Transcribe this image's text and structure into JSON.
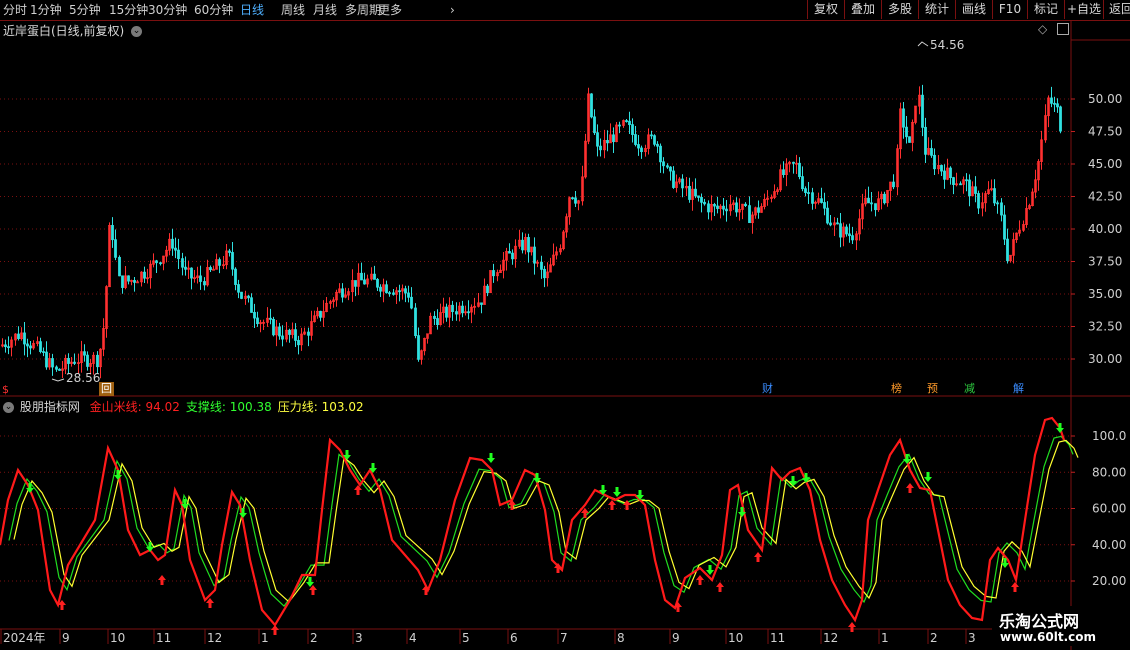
{
  "toolbar": {
    "periods": [
      "分时",
      "1分钟",
      "5分钟",
      "15分钟",
      "30分钟",
      "60分钟",
      "日线",
      "周线",
      "月线",
      "多周期",
      "更多"
    ],
    "active_period": "日线",
    "more_arrow": "›",
    "right_buttons": [
      "复权",
      "叠加",
      "多股",
      "统计",
      "画线",
      "F10",
      "标记",
      "+自选",
      "返回"
    ]
  },
  "price_panel": {
    "title": "近岸蛋白(日线,前复权)",
    "high_label": "54.56",
    "low_label": "28.56",
    "s_marker": "$",
    "hui_badge": "回",
    "event_badges": [
      {
        "text": "财",
        "color": "#3a8cff"
      },
      {
        "text": "榜",
        "color": "#ff9a2a"
      },
      {
        "text": "预",
        "color": "#ff9a2a"
      },
      {
        "text": "减",
        "color": "#2ecc40"
      },
      {
        "text": "解",
        "color": "#3a8cff"
      }
    ],
    "y_ticks": [
      "50.00",
      "47.50",
      "45.00",
      "42.50",
      "40.00",
      "37.50",
      "35.00",
      "32.50",
      "30.00"
    ]
  },
  "indicator_panel": {
    "name": "股朋指标网",
    "lines": [
      {
        "label": "金山米线:",
        "value": "94.02",
        "color": "#ff2020"
      },
      {
        "label": "支撑线:",
        "value": "100.38",
        "color": "#30ff30"
      },
      {
        "label": "压力线:",
        "value": "103.02",
        "color": "#ffff40"
      }
    ],
    "y_ticks": [
      "100.0",
      "80.00",
      "60.00",
      "40.00",
      "20.00"
    ]
  },
  "x_axis": {
    "labels": [
      "2024年",
      "9",
      "10",
      "11",
      "12",
      "1",
      "2",
      "3",
      "4",
      "5",
      "6",
      "7",
      "8",
      "9",
      "10",
      "11",
      "12",
      "1",
      "2",
      "3"
    ]
  },
  "colors": {
    "up": "#ff3030",
    "down": "#30e0e0",
    "grid": "#7a1010",
    "k_line": "#ff1a1a",
    "d_line": "#20dd20",
    "j_line": "#ffff30"
  },
  "watermark": {
    "line1": "乐淘公式网",
    "line2": "www.60lt.com"
  }
}
